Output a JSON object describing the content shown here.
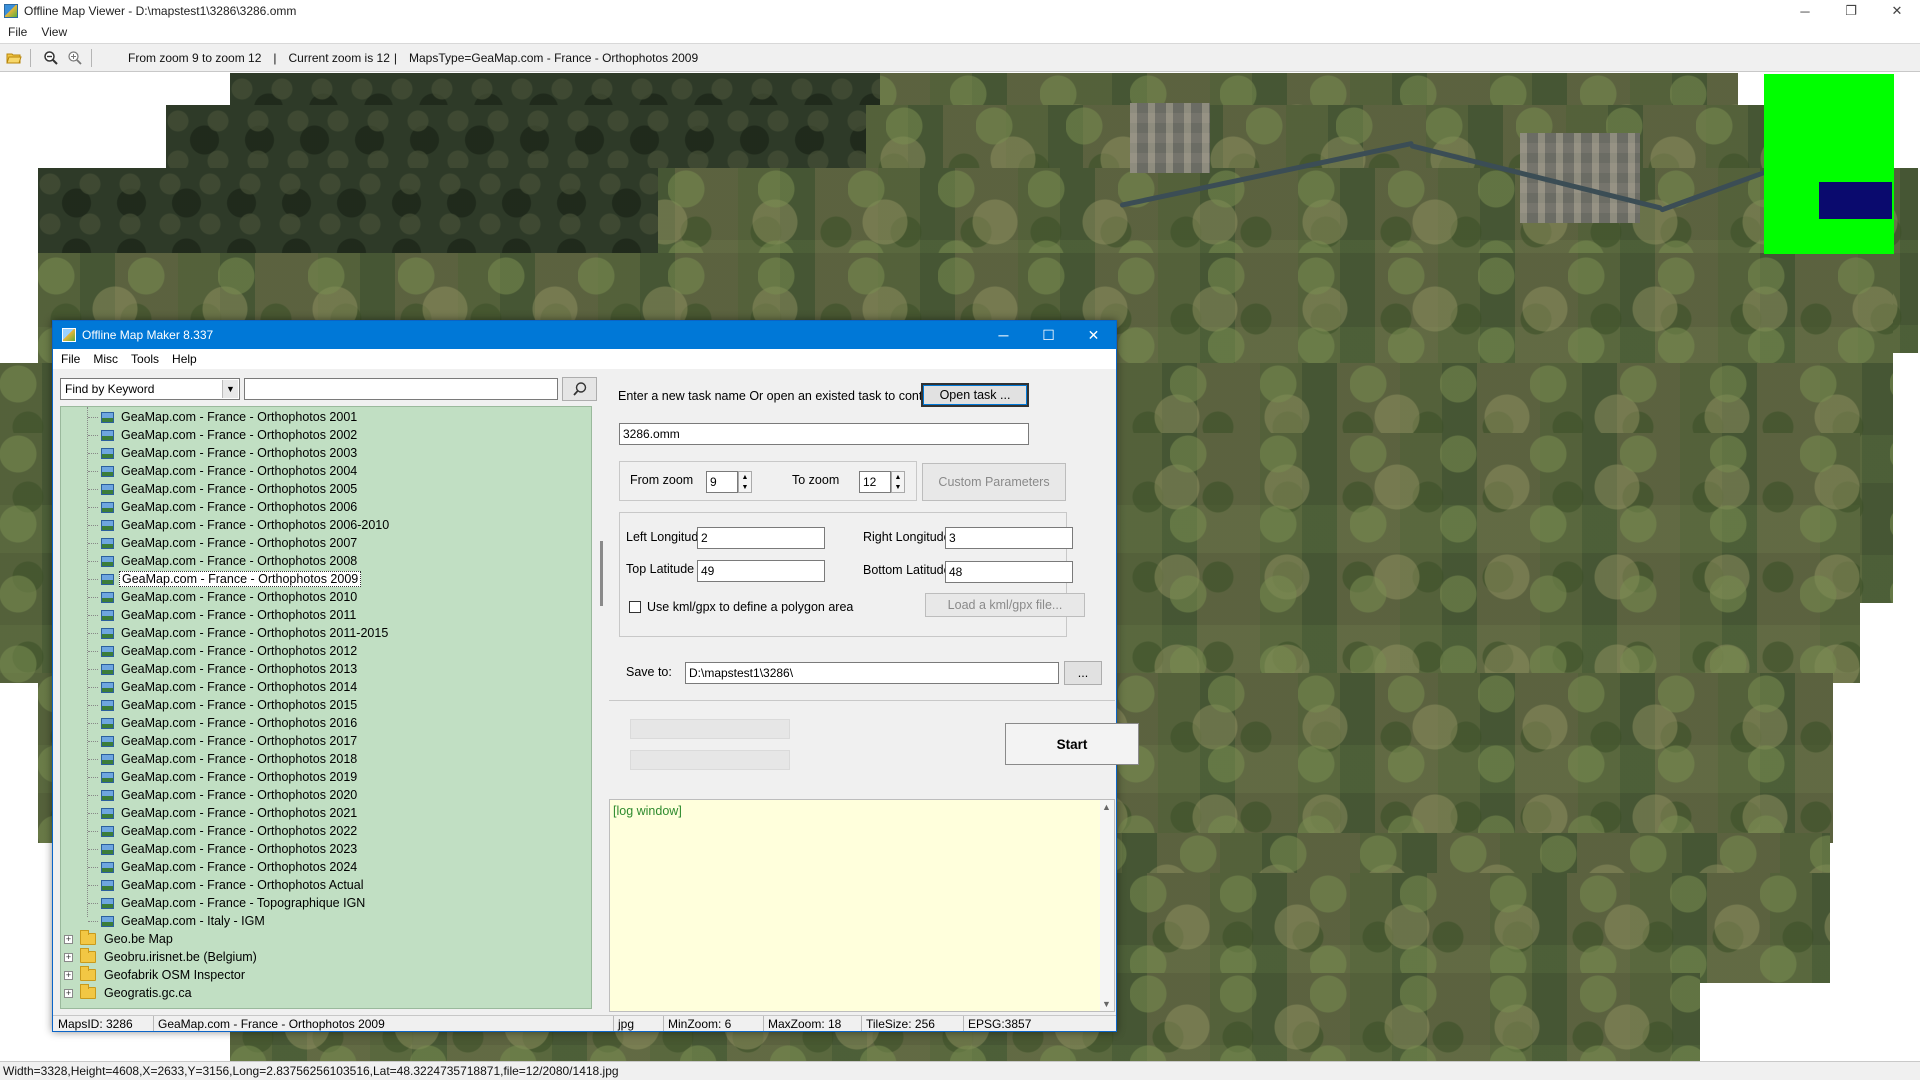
{
  "viewer": {
    "title": "Offline Map Viewer - D:\\mapstest1\\3286\\3286.omm",
    "window_buttons": [
      "─",
      "❐",
      "✕"
    ],
    "menu": [
      "File",
      "View"
    ],
    "toolbar": {
      "zoom_range": "From zoom 9 to zoom 12",
      "current_zoom": "Current zoom is 12",
      "maps_type": "MapsType=GeaMap.com - France - Orthophotos 2009",
      "separator": "|"
    },
    "status": "Width=3328,Height=4608,X=2633,Y=3156,Long=2.83756256103516,Lat=48.3224735718871,file=12/2080/1418.jpg"
  },
  "dialog": {
    "title": "Offline Map Maker 8.337",
    "window_buttons": [
      "─",
      "☐",
      "✕"
    ],
    "menu": [
      "File",
      "Misc",
      "Tools",
      "Help"
    ],
    "search": {
      "mode": "Find by Keyword",
      "query": "",
      "search_icon": "magnifier-icon"
    },
    "tree": {
      "leaves": [
        "GeaMap.com - France - Orthophotos 2001",
        "GeaMap.com - France - Orthophotos 2002",
        "GeaMap.com - France - Orthophotos 2003",
        "GeaMap.com - France - Orthophotos 2004",
        "GeaMap.com - France - Orthophotos 2005",
        "GeaMap.com - France - Orthophotos 2006",
        "GeaMap.com - France - Orthophotos 2006-2010",
        "GeaMap.com - France - Orthophotos 2007",
        "GeaMap.com - France - Orthophotos 2008",
        "GeaMap.com - France - Orthophotos 2009",
        "GeaMap.com - France - Orthophotos 2010",
        "GeaMap.com - France - Orthophotos 2011",
        "GeaMap.com - France - Orthophotos 2011-2015",
        "GeaMap.com - France - Orthophotos 2012",
        "GeaMap.com - France - Orthophotos 2013",
        "GeaMap.com - France - Orthophotos 2014",
        "GeaMap.com - France - Orthophotos 2015",
        "GeaMap.com - France - Orthophotos 2016",
        "GeaMap.com - France - Orthophotos 2017",
        "GeaMap.com - France - Orthophotos 2018",
        "GeaMap.com - France - Orthophotos 2019",
        "GeaMap.com - France - Orthophotos 2020",
        "GeaMap.com - France - Orthophotos 2021",
        "GeaMap.com - France - Orthophotos 2022",
        "GeaMap.com - France - Orthophotos 2023",
        "GeaMap.com - France - Orthophotos 2024",
        "GeaMap.com - France - Orthophotos Actual",
        "GeaMap.com - France - Topographique IGN",
        "GeaMap.com - Italy - IGM"
      ],
      "selected": "GeaMap.com - France - Orthophotos 2009",
      "folders": [
        "Geo.be Map",
        "Geobru.irisnet.be (Belgium)",
        "Geofabrik OSM Inspector",
        "Geogratis.gc.ca"
      ],
      "expand_glyph": "+"
    },
    "task": {
      "prompt": "Enter a new task name Or open an existed task to continue:",
      "open_button": "Open task ...",
      "name": "3286.omm",
      "from_zoom_label": "From zoom",
      "from_zoom": "9",
      "to_zoom_label": "To zoom",
      "to_zoom": "12",
      "custom_params_button": "Custom Parameters",
      "left_longitude_label": "Left Longitude",
      "left_longitude": "2",
      "right_longitude_label": "Right Longitude",
      "right_longitude": "3",
      "top_latitude_label": "Top Latitude",
      "top_latitude": "49",
      "bottom_latitude_label": "Bottom Latitude",
      "bottom_latitude": "48",
      "kml_checkbox_label": "Use kml/gpx to define a polygon area",
      "kml_checked": false,
      "load_kml_button": "Load a kml/gpx file...",
      "save_to_label": "Save to:",
      "save_to": "D:\\mapstest1\\3286\\",
      "browse_button": "...",
      "start_button": "Start",
      "log": "[log window]"
    },
    "status": {
      "maps_id": "MapsID: 3286",
      "map_name": "GeaMap.com - France - Orthophotos 2009",
      "format": "jpg",
      "min_zoom": "MinZoom: 6",
      "max_zoom": "MaxZoom: 18",
      "tile_size": "TileSize: 256",
      "epsg": "EPSG:3857"
    }
  },
  "colors": {
    "dialog_title": "#0078d7",
    "tree_background": "#c1dfc3",
    "log_background": "#ffffdc",
    "log_text": "#2e8b2e",
    "overview_area": "#00ff00",
    "overview_viewport": "#0a0a6e"
  }
}
